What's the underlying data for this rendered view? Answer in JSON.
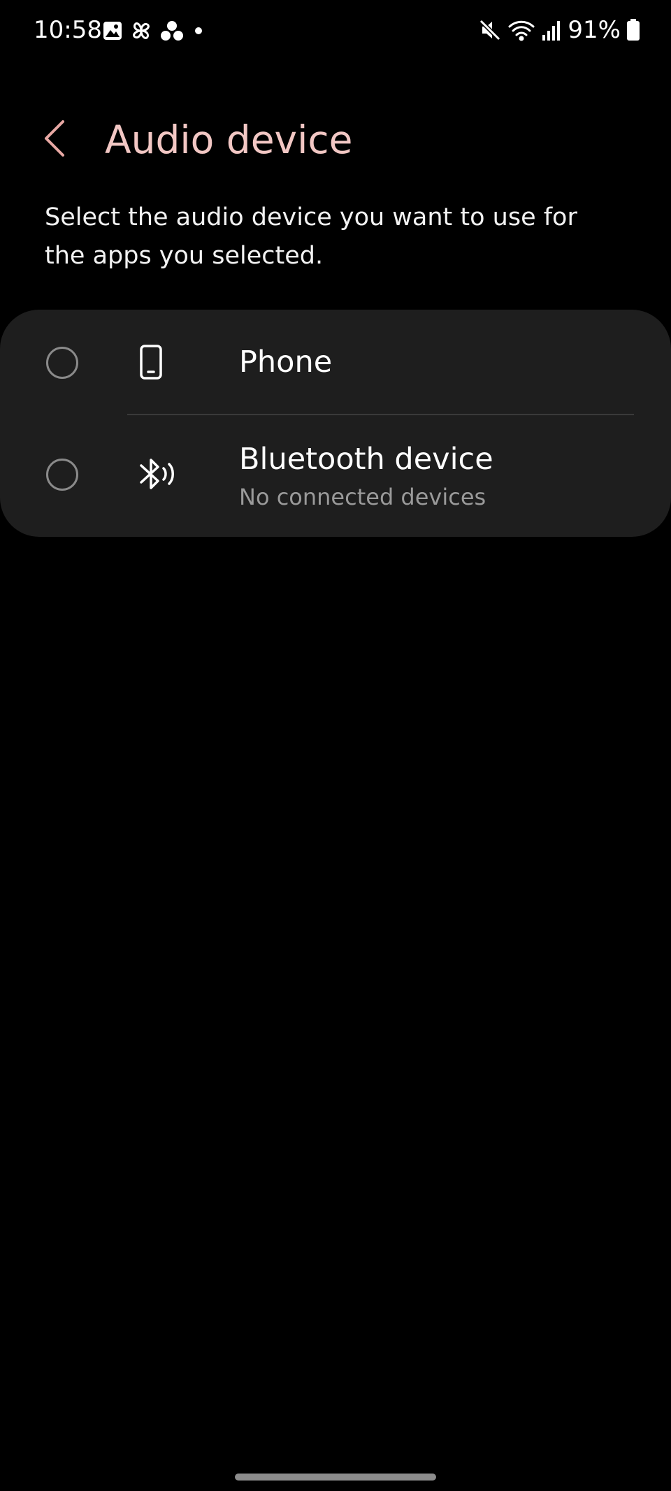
{
  "status_bar": {
    "time": "10:58",
    "left_icons": [
      "gallery-icon",
      "pinwheel-icon",
      "three-dots-app-icon",
      "notification-dot-icon"
    ],
    "right_icons": [
      "mute-icon",
      "wifi-icon",
      "signal-icon",
      "battery-icon"
    ],
    "battery_percent": "91%"
  },
  "header": {
    "back_icon": "chevron-left-icon",
    "title": "Audio device"
  },
  "description": "Select the audio device you want to use for the apps you selected.",
  "options": [
    {
      "icon": "phone-icon",
      "title": "Phone",
      "subtitle": "",
      "selected": false
    },
    {
      "icon": "bluetooth-audio-icon",
      "title": "Bluetooth device",
      "subtitle": "No connected devices",
      "selected": false
    }
  ],
  "colors": {
    "background": "#000000",
    "card": "#1e1e1e",
    "title_accent": "#f2c7c4",
    "back_chevron": "#e8a8a4",
    "radio_border": "#8a8a8a",
    "subtitle": "#9a9a9a"
  }
}
